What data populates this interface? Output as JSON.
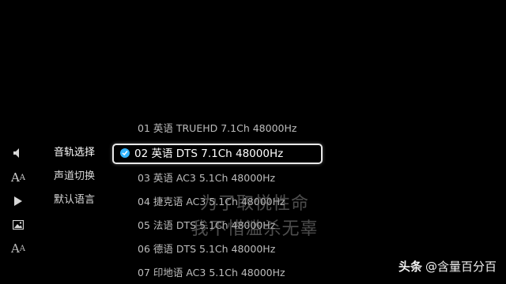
{
  "icons": [
    "volume-icon",
    "font-size-icon",
    "play-icon",
    "image-icon",
    "subtitle-font-icon"
  ],
  "menu": {
    "items": [
      {
        "label": "音轨选择",
        "active": true
      },
      {
        "label": "声道切换",
        "active": false
      },
      {
        "label": "默认语言",
        "active": false
      }
    ]
  },
  "tracks": [
    {
      "label": "01  英语  TRUEHD  7.1Ch  48000Hz",
      "selected": false
    },
    {
      "label": "02  英语  DTS  7.1Ch  48000Hz",
      "selected": true
    },
    {
      "label": "03  英语  AC3  5.1Ch  48000Hz",
      "selected": false
    },
    {
      "label": "04  捷克语  AC3  5.1Ch  48000Hz",
      "selected": false
    },
    {
      "label": "05  法语  DTS  5.1Ch  48000Hz",
      "selected": false
    },
    {
      "label": "06  德语  DTS  5.1Ch  48000Hz",
      "selected": false
    },
    {
      "label": "07  印地语  AC3  5.1Ch  48000Hz",
      "selected": false
    }
  ],
  "subtitle": {
    "line1": "为了取悦性命",
    "line2": "我不惜滥杀无辜"
  },
  "watermark": {
    "brand": "头条",
    "handle": "@含量百分百"
  },
  "colors": {
    "accent": "#33b5ff",
    "background": "#000000"
  }
}
